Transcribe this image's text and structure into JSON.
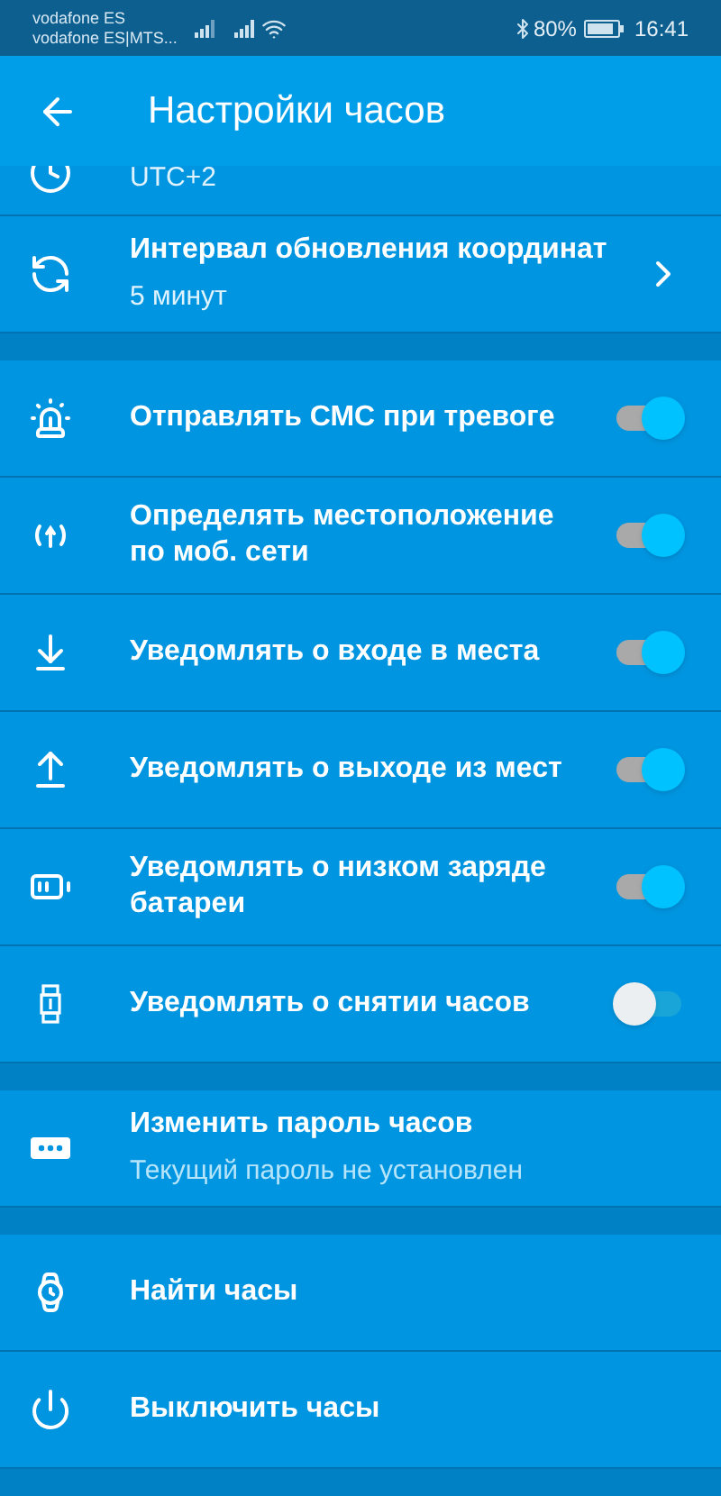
{
  "status_bar": {
    "carrier_1": "vodafone ES",
    "carrier_2": "vodafone ES|MTS...",
    "battery": "80%",
    "time": "16:41"
  },
  "header": {
    "title": "Настройки часов"
  },
  "sections": [
    {
      "items": [
        {
          "kind": "clipped",
          "subtitle": "UTC+2"
        },
        {
          "kind": "nav",
          "title": "Интервал обновления координат",
          "subtitle": "5 минут"
        }
      ]
    },
    {
      "items": [
        {
          "kind": "toggle",
          "title": "Отправлять СМС при тревоге",
          "on": true
        },
        {
          "kind": "toggle",
          "title": "Определять местоположение по моб. сети",
          "on": true
        },
        {
          "kind": "toggle",
          "title": "Уведомлять о входе в места",
          "on": true
        },
        {
          "kind": "toggle",
          "title": "Уведомлять о выходе из мест",
          "on": true
        },
        {
          "kind": "toggle",
          "title": "Уведомлять о низком заряде батареи",
          "on": true
        },
        {
          "kind": "toggle",
          "title": "Уведомлять о снятии часов",
          "on": false
        }
      ]
    },
    {
      "items": [
        {
          "kind": "info",
          "title": "Изменить пароль часов",
          "subtitle": "Текущий пароль не установлен"
        }
      ]
    },
    {
      "items": [
        {
          "kind": "action",
          "title": "Найти часы"
        },
        {
          "kind": "action",
          "title": "Выключить часы"
        }
      ]
    }
  ]
}
